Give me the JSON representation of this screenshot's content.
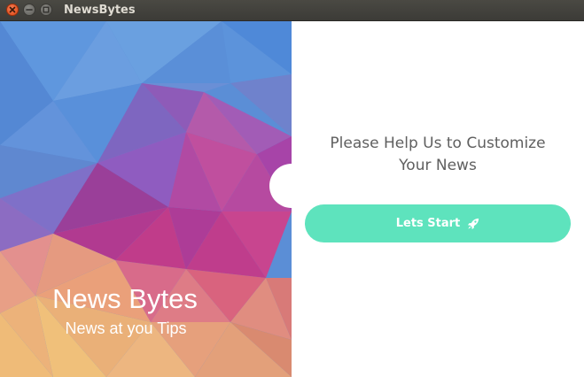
{
  "window": {
    "title": "NewsBytes"
  },
  "brand": {
    "name": "News Bytes",
    "tagline": "News at you Tips"
  },
  "onboarding": {
    "prompt_line1": "Please Help Us to Customize",
    "prompt_line2": "Your News",
    "start_button_label": "Lets Start",
    "start_button_icon": "rocket-icon",
    "button_color": "#5ee3bd"
  },
  "colors": {
    "titlebar": "#3c3b37",
    "close_button": "#df4a16",
    "prompt_text": "#5f5f5f"
  }
}
